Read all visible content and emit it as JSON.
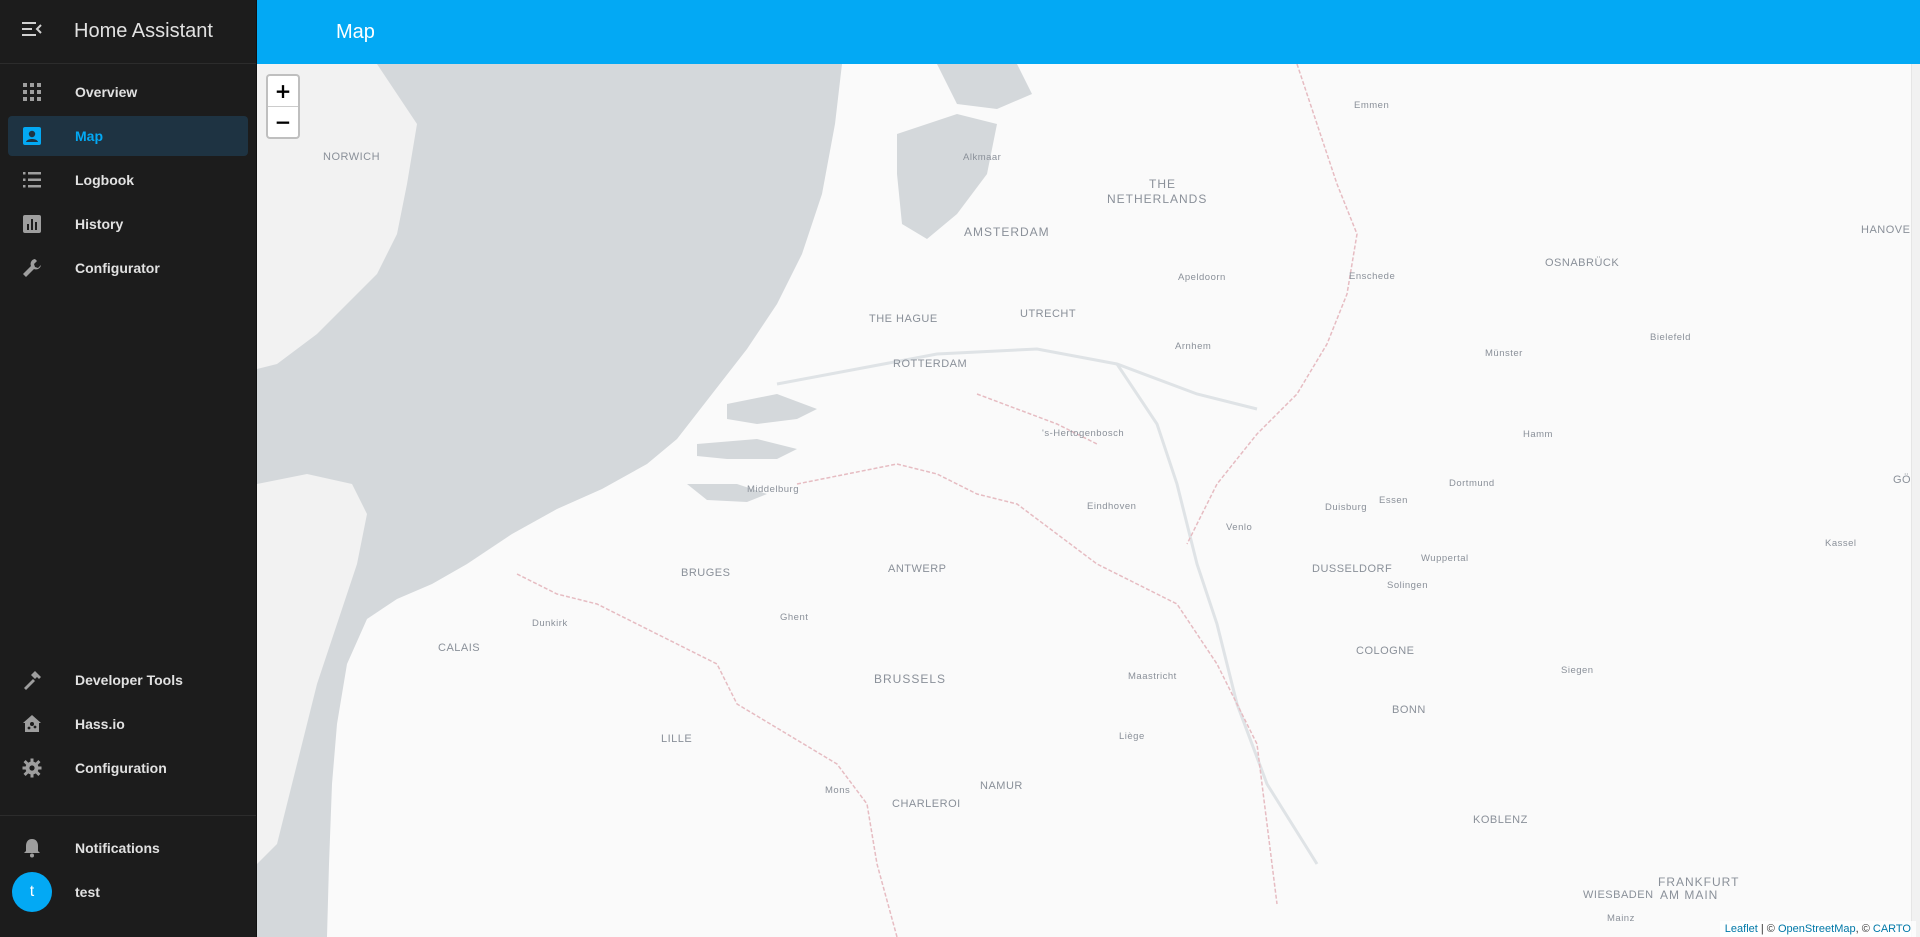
{
  "app": {
    "title": "Home Assistant"
  },
  "sidebar": {
    "items": [
      {
        "label": "Overview",
        "icon": "grid-icon",
        "active": false
      },
      {
        "label": "Map",
        "icon": "account-box-icon",
        "active": true
      },
      {
        "label": "Logbook",
        "icon": "list-icon",
        "active": false
      },
      {
        "label": "History",
        "icon": "chart-box-icon",
        "active": false
      },
      {
        "label": "Configurator",
        "icon": "wrench-icon",
        "active": false
      }
    ],
    "bottom_items": [
      {
        "label": "Developer Tools",
        "icon": "hammer-icon"
      },
      {
        "label": "Hass.io",
        "icon": "home-assistant-icon"
      },
      {
        "label": "Configuration",
        "icon": "gear-icon"
      }
    ],
    "notifications": {
      "label": "Notifications",
      "icon": "bell-icon"
    },
    "user": {
      "initial": "t",
      "name": "test"
    }
  },
  "header": {
    "title": "Map"
  },
  "map": {
    "zoom_in": "+",
    "zoom_out": "−",
    "attribution": {
      "leaflet": "Leaflet",
      "sep1": " | © ",
      "osm": "OpenStreetMap",
      "sep2": ", © ",
      "carto": "CARTO"
    },
    "labels": [
      {
        "text": "NORWICH"
      },
      {
        "text": "Alkmaar"
      },
      {
        "text": "THE"
      },
      {
        "text": "NETHERLANDS"
      },
      {
        "text": "AMSTERDAM"
      },
      {
        "text": "Emmen"
      },
      {
        "text": "HANOVE"
      },
      {
        "text": "OSNABRÜCK"
      },
      {
        "text": "Apeldoorn"
      },
      {
        "text": "Enschede"
      },
      {
        "text": "THE HAGUE"
      },
      {
        "text": "UTRECHT"
      },
      {
        "text": "Bielefeld"
      },
      {
        "text": "Arnhem"
      },
      {
        "text": "ROTTERDAM"
      },
      {
        "text": "Münster"
      },
      {
        "text": "'s-Hertogenbosch"
      },
      {
        "text": "Hamm"
      },
      {
        "text": "Middelburg"
      },
      {
        "text": "Eindhoven"
      },
      {
        "text": "Essen"
      },
      {
        "text": "Dortmund"
      },
      {
        "text": "Duisburg"
      },
      {
        "text": "Venlo"
      },
      {
        "text": "Kassel"
      },
      {
        "text": "Wuppertal"
      },
      {
        "text": "BRUGES"
      },
      {
        "text": "ANTWERP"
      },
      {
        "text": "DUSSELDORF"
      },
      {
        "text": "Solingen"
      },
      {
        "text": "Dunkirk"
      },
      {
        "text": "Ghent"
      },
      {
        "text": "CALAIS"
      },
      {
        "text": "COLOGNE"
      },
      {
        "text": "Siegen"
      },
      {
        "text": "BRUSSELS"
      },
      {
        "text": "Maastricht"
      },
      {
        "text": "BONN"
      },
      {
        "text": "LILLE"
      },
      {
        "text": "Liège"
      },
      {
        "text": "NAMUR"
      },
      {
        "text": "Mons"
      },
      {
        "text": "CHARLEROI"
      },
      {
        "text": "KOBLENZ"
      },
      {
        "text": "FRANKFURT"
      },
      {
        "text": "AM MAIN"
      },
      {
        "text": "WIESBADEN"
      },
      {
        "text": "Mainz"
      },
      {
        "text": "GÖ"
      }
    ]
  }
}
